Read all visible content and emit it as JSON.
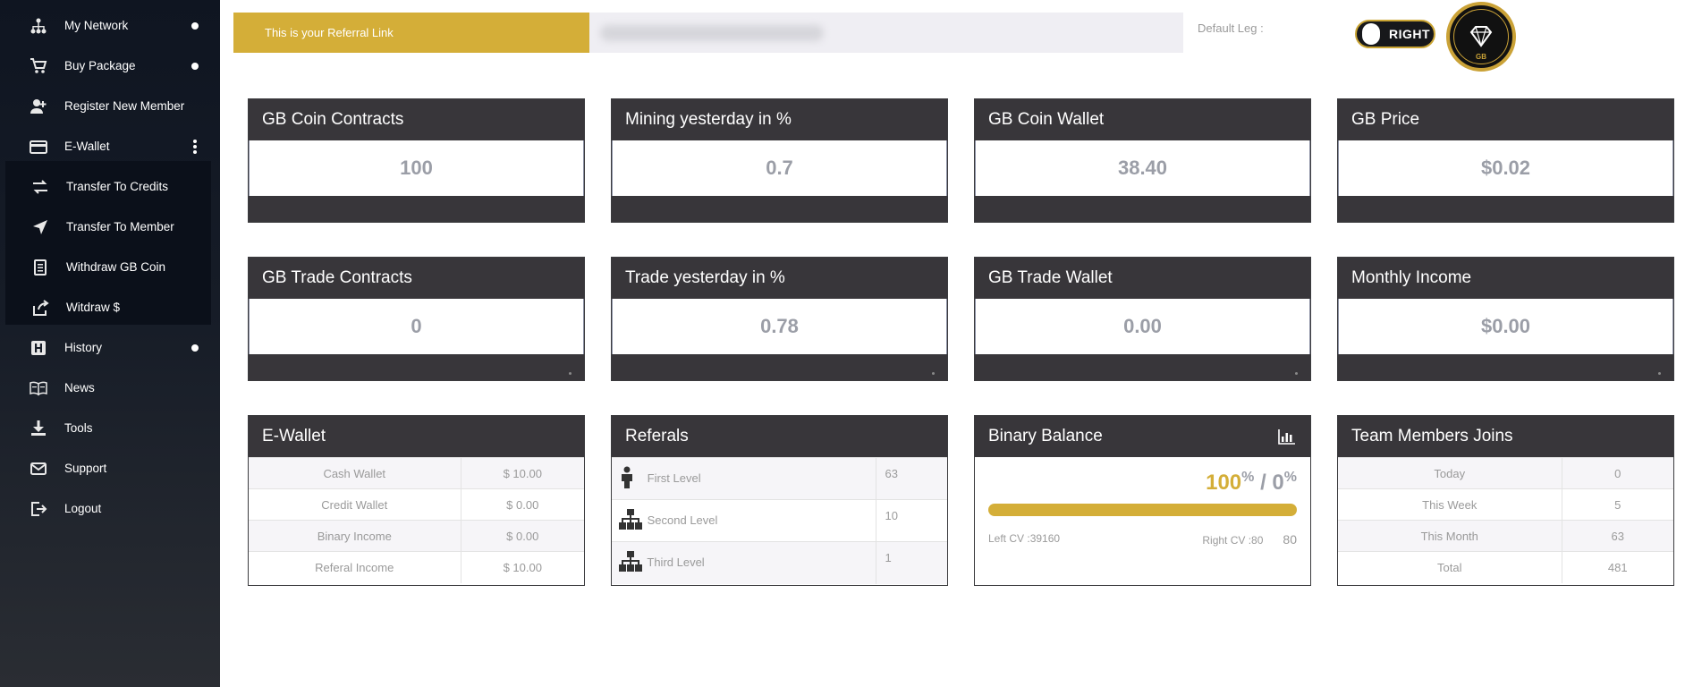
{
  "sidebar": {
    "items": [
      {
        "label": "My Network",
        "icon": "network-icon"
      },
      {
        "label": "Buy Package",
        "icon": "cart-icon"
      },
      {
        "label": "Register New Member",
        "icon": "add-user-icon"
      },
      {
        "label": "E-Wallet",
        "icon": "wallet-icon"
      },
      {
        "label": "Transfer To Credits",
        "icon": "transfer-icon"
      },
      {
        "label": "Transfer To Member",
        "icon": "send-icon"
      },
      {
        "label": "Withdraw GB Coin",
        "icon": "document-icon"
      },
      {
        "label": "Witdraw $",
        "icon": "share-icon"
      },
      {
        "label": "History",
        "icon": "history-icon"
      },
      {
        "label": "News",
        "icon": "book-icon"
      },
      {
        "label": "Tools",
        "icon": "download-icon"
      },
      {
        "label": "Support",
        "icon": "mail-icon"
      },
      {
        "label": "Logout",
        "icon": "logout-icon"
      }
    ]
  },
  "topbar": {
    "referral_label": "This is your Referral Link",
    "default_leg_label": "Default Leg :",
    "toggle_label": "RIGHT",
    "logo_text": "GB"
  },
  "stats": [
    {
      "title": "GB Coin Contracts",
      "value": "100"
    },
    {
      "title": "Mining yesterday in %",
      "value": "0.7"
    },
    {
      "title": "GB Coin Wallet",
      "value": "38.40"
    },
    {
      "title": "GB Price",
      "value": "$0.02"
    },
    {
      "title": "GB Trade Contracts",
      "value": "0"
    },
    {
      "title": "Trade yesterday in %",
      "value": "0.78"
    },
    {
      "title": "GB Trade Wallet",
      "value": "0.00"
    },
    {
      "title": "Monthly Income",
      "value": "$0.00"
    }
  ],
  "ewallet": {
    "title": "E-Wallet",
    "rows": [
      {
        "label": "Cash Wallet",
        "value": "$ 10.00"
      },
      {
        "label": "Credit Wallet",
        "value": "$ 0.00"
      },
      {
        "label": "Binary Income",
        "value": "$ 0.00"
      },
      {
        "label": "Referal Income",
        "value": "$ 10.00"
      }
    ]
  },
  "referals": {
    "title": "Referals",
    "rows": [
      {
        "label": "First Level",
        "value": "63",
        "icon": "person-icon"
      },
      {
        "label": "Second Level",
        "value": "10",
        "icon": "hierarchy-icon"
      },
      {
        "label": "Third Level",
        "value": "1",
        "icon": "hierarchy-icon"
      }
    ]
  },
  "binary": {
    "title": "Binary Balance",
    "left_pct": "100",
    "right_pct": "0",
    "pct_sign": "%",
    "separator": "/",
    "left_fraction": 1.0,
    "left_cv": "Left CV :39160",
    "right_cv": "Right CV :80",
    "right_value": "80"
  },
  "team": {
    "title": "Team Members Joins",
    "rows": [
      {
        "label": "Today",
        "value": "0"
      },
      {
        "label": "This Week",
        "value": "5"
      },
      {
        "label": "This Month",
        "value": "63"
      },
      {
        "label": "Total",
        "value": "481"
      }
    ]
  },
  "colors": {
    "accent": "#d4ae38",
    "card_head": "#38363a",
    "sidebar": "#161c27"
  }
}
